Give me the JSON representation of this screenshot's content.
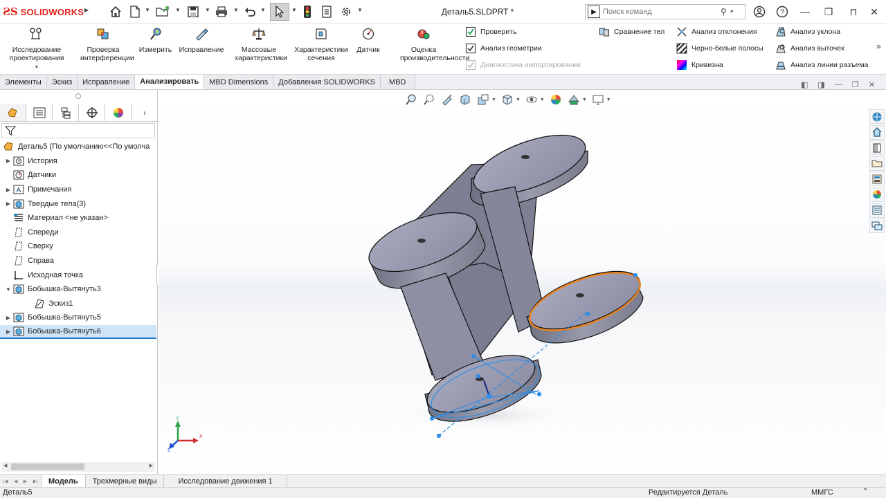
{
  "app": {
    "brand": "SOLIDWORKS",
    "document_title": "Деталь5.SLDPRT *",
    "search_placeholder": "Поиск команд"
  },
  "ribbon": {
    "big_buttons": [
      {
        "label": "Исследование проектирования",
        "icon": "design-study-icon"
      },
      {
        "label": "Проверка интерференции",
        "icon": "interference-icon"
      },
      {
        "label": "Измерить",
        "icon": "measure-icon"
      },
      {
        "label": "Исправление",
        "icon": "repair-icon"
      },
      {
        "label": "Массовые характеристики",
        "icon": "mass-properties-icon"
      },
      {
        "label": "Характеристики сечения",
        "icon": "section-properties-icon"
      },
      {
        "label": "Датчик",
        "icon": "sensor-icon"
      },
      {
        "label": "Оценка производительности",
        "icon": "performance-icon"
      }
    ],
    "small_buttons": [
      {
        "label": "Проверить",
        "icon": "check-icon",
        "enabled": true
      },
      {
        "label": "Анализ геометрии",
        "icon": "geometry-analysis-icon",
        "enabled": true
      },
      {
        "label": "Диагностика импортирования",
        "icon": "import-diagnostics-icon",
        "enabled": false
      },
      {
        "label": "Сравнение тел",
        "icon": "compare-bodies-icon",
        "enabled": true
      },
      {
        "label": "Анализ отклонения",
        "icon": "deviation-icon",
        "enabled": true
      },
      {
        "label": "Черно-белые полосы",
        "icon": "zebra-icon",
        "enabled": true
      },
      {
        "label": "Кривизна",
        "icon": "curvature-icon",
        "enabled": true
      },
      {
        "label": "Анализ уклона",
        "icon": "draft-icon",
        "enabled": true
      },
      {
        "label": "Анализ выточек",
        "icon": "undercut-icon",
        "enabled": true
      },
      {
        "label": "Анализ линии разъема",
        "icon": "parting-line-icon",
        "enabled": true
      }
    ]
  },
  "command_tabs": [
    "Элементы",
    "Эскиз",
    "Исправление",
    "Анализировать",
    "MBD Dimensions",
    "Добавления SOLIDWORKS",
    "MBD"
  ],
  "active_command_tab": "Анализировать",
  "tree": {
    "root": "Деталь5  (По умолчанию<<По умолча",
    "items": [
      {
        "label": "История",
        "icon": "history-icon",
        "expand": true
      },
      {
        "label": "Датчики",
        "icon": "sensor-icon",
        "expand": false
      },
      {
        "label": "Примечания",
        "icon": "annotations-icon",
        "expand": true
      },
      {
        "label": "Твердые тела(3)",
        "icon": "solid-bodies-icon",
        "expand": true
      },
      {
        "label": "Материал <не указан>",
        "icon": "material-icon",
        "expand": false
      },
      {
        "label": "Спереди",
        "icon": "plane-icon",
        "expand": false
      },
      {
        "label": "Сверху",
        "icon": "plane-icon",
        "expand": false
      },
      {
        "label": "Справа",
        "icon": "plane-icon",
        "expand": false
      },
      {
        "label": "Исходная точка",
        "icon": "origin-icon",
        "expand": false
      },
      {
        "label": "Бобышка-Вытянуть3",
        "icon": "extrude-icon",
        "expand": "open"
      },
      {
        "label": "Эскиз1",
        "icon": "sketch-icon",
        "expand": false,
        "child": true
      },
      {
        "label": "Бобышка-Вытянуть5",
        "icon": "extrude-icon",
        "expand": true
      },
      {
        "label": "Бобышка-Вытянуть6",
        "icon": "extrude-icon",
        "expand": true,
        "selected": true
      }
    ]
  },
  "bottom_tabs": [
    "Модель",
    "Трехмерные виды",
    "Исследование движения 1"
  ],
  "active_bottom_tab": "Модель",
  "status": {
    "left": "Деталь5",
    "mode": "Редактируется Деталь",
    "units": "ММГС"
  },
  "triad": {
    "x": "X",
    "y": "Y",
    "z": "Z"
  },
  "colors": {
    "brand": "#e2231a",
    "selection": "#cfe4f7",
    "highlight_edge": "#e8821e",
    "sketch_blue": "#2f8fe6",
    "body": "#8e8e9f"
  }
}
